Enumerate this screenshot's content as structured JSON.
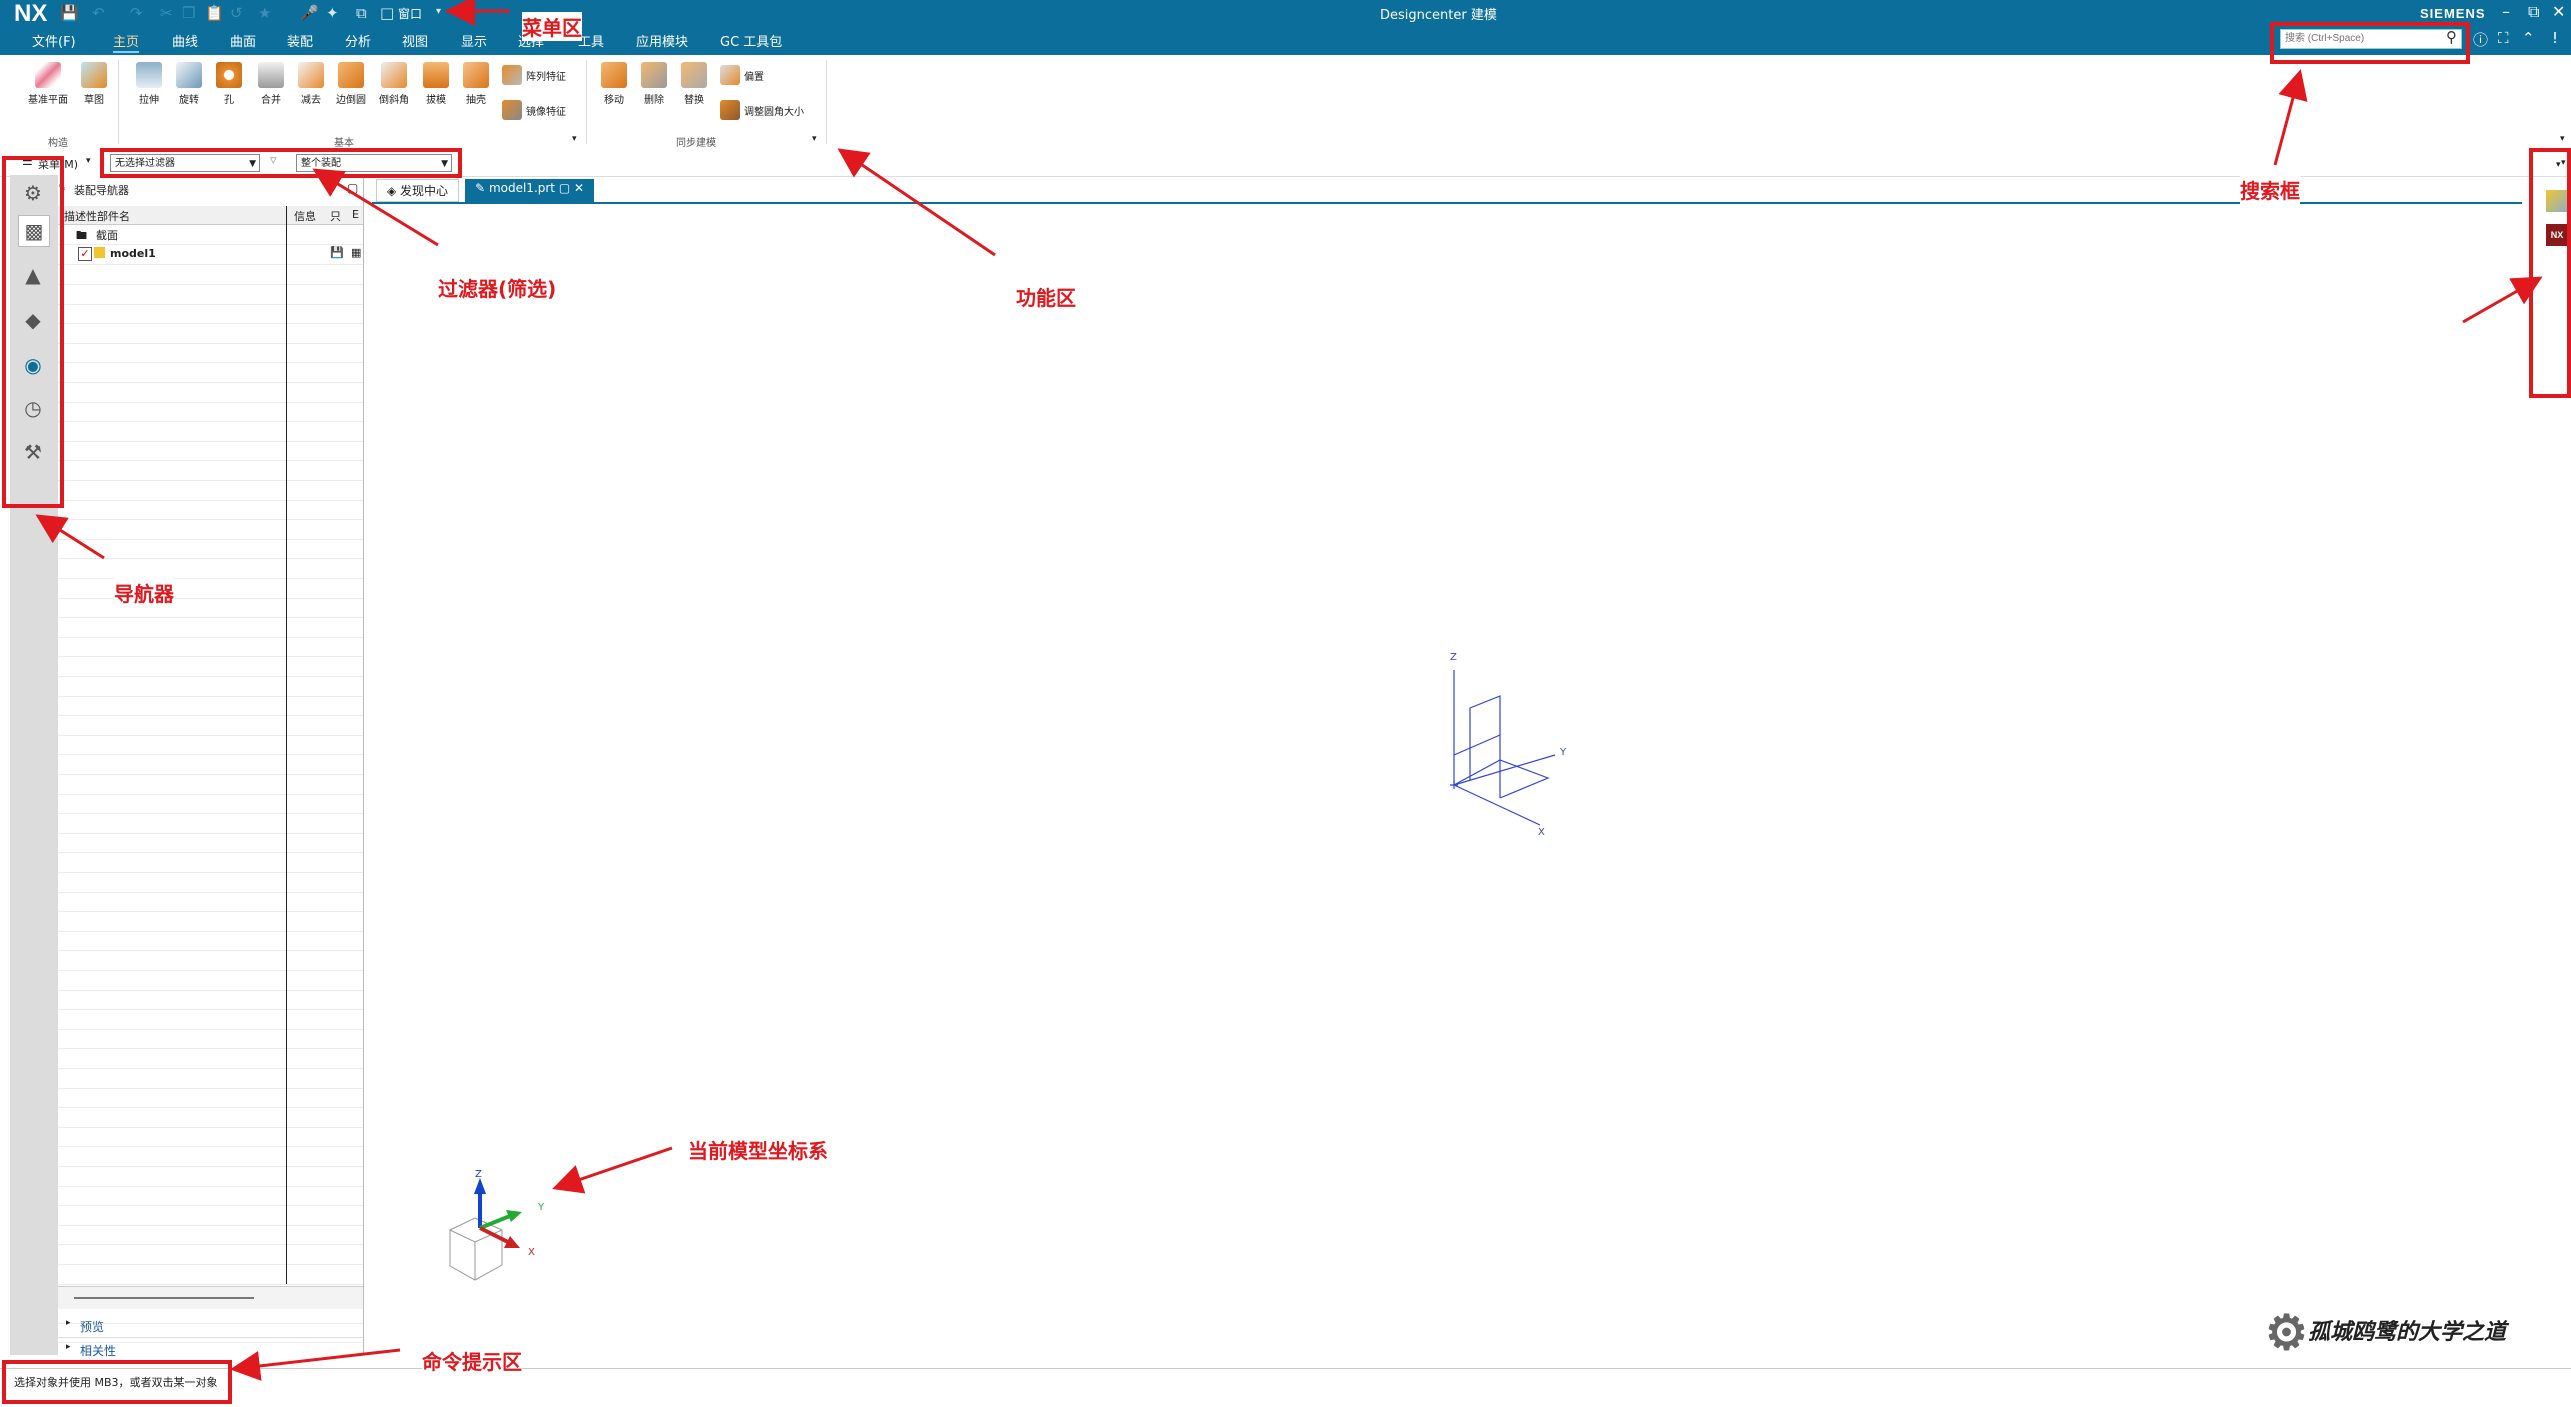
{
  "app": {
    "logo": "NX",
    "window_title": "Designcenter 建模",
    "brand": "SIEMENS"
  },
  "quick_access": {
    "window_label": "窗口"
  },
  "menu": {
    "file": "文件(F)",
    "tabs": [
      "主页",
      "曲线",
      "曲面",
      "装配",
      "分析",
      "视图",
      "显示",
      "选择",
      "工具",
      "应用模块",
      "GC 工具包"
    ]
  },
  "search": {
    "placeholder": "搜索 (Ctrl+Space)"
  },
  "ribbon": {
    "construct": {
      "datum_plane": "基准平面",
      "sketch": "草图",
      "group": "构造"
    },
    "basic": {
      "extrude": "拉伸",
      "revolve": "旋转",
      "hole": "孔",
      "unite": "合并",
      "subtract": "减去",
      "edge_blend": "边倒圆",
      "chamfer": "倒斜角",
      "draft": "拔模",
      "shell": "抽壳",
      "pattern_feature": "阵列特征",
      "mirror_feature": "镜像特征",
      "group": "基本"
    },
    "sync": {
      "move": "移动",
      "delete": "删除",
      "replace": "替换",
      "offset": "偏置",
      "resize_blend": "调整圆角大小",
      "group": "同步建模"
    }
  },
  "filterbar": {
    "menu_label": "菜单(M)",
    "type_filter": "无选择过滤器",
    "scope": "整个装配"
  },
  "navigator": {
    "title": "装配导航器",
    "columns": {
      "name": "描述性部件名",
      "info": "信息",
      "readonly": "只",
      "edit": "E"
    },
    "rows": [
      {
        "label": "截面"
      },
      {
        "label": "model1"
      }
    ],
    "preview": "预览",
    "dependencies": "相关性"
  },
  "doc_tabs": {
    "discovery": "发现中心",
    "model": "model1.prt"
  },
  "triad": {
    "z": "Z",
    "y": "Y",
    "x": "X"
  },
  "status": {
    "message": "选择对象并使用 MB3，或者双击某一对象"
  },
  "annotations": {
    "menu_area": "菜单区",
    "search_box": "搜索框",
    "filter": "过滤器(筛选)",
    "function_area": "功能区",
    "navigator": "导航器",
    "coord_system": "当前模型坐标系",
    "cmd_prompt": "命令提示区"
  },
  "watermark": "孤城鸥鹭的大学之道",
  "colors": {
    "titlebar": "#0b6e9b",
    "annotation": "#e0191f",
    "wcs": "#3344dd"
  }
}
